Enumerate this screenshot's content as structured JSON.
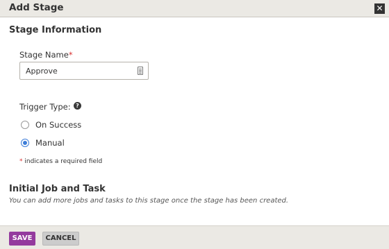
{
  "dialog": {
    "title": "Add Stage",
    "close_glyph": "✕"
  },
  "stage_info": {
    "heading": "Stage Information",
    "stage_name_label": "Stage Name",
    "required_marker": "*",
    "stage_name_value": "Approve",
    "trigger_type_label": "Trigger Type:",
    "help_glyph": "?",
    "options": [
      {
        "label": "On Success",
        "selected": false
      },
      {
        "label": "Manual",
        "selected": true
      }
    ],
    "required_note_marker": "*",
    "required_note": " indicates a required field"
  },
  "initial_job": {
    "heading": "Initial Job and Task",
    "description": "You can add more jobs and tasks to this stage once the stage has been created."
  },
  "footer": {
    "save_label": "SAVE",
    "cancel_label": "CANCEL"
  },
  "colors": {
    "save_button": "#943a9e",
    "radio_selected": "#3c7dd8",
    "required": "#d8302f"
  },
  "icons": [
    "close-icon",
    "field-list-icon",
    "help-icon"
  ]
}
